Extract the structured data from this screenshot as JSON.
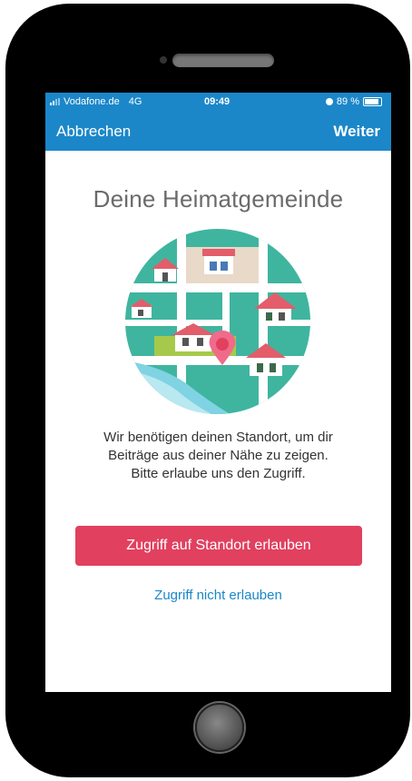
{
  "status_bar": {
    "carrier": "Vodafone.de",
    "network": "4G",
    "time": "09:49",
    "battery": "89 %"
  },
  "nav": {
    "cancel_label": "Abbrechen",
    "next_label": "Weiter"
  },
  "main": {
    "title": "Deine Heimatgemeinde",
    "description_lines": [
      "Wir benötigen deinen Standort, um dir",
      "Beiträge aus deiner Nähe zu zeigen.",
      "Bitte erlaube uns den Zugriff."
    ],
    "allow_button": "Zugriff auf Standort erlauben",
    "deny_link": "Zugriff nicht erlauben"
  },
  "colors": {
    "nav_blue": "#1b87c9",
    "accent_red": "#e1405f",
    "map_teal": "#3fb59f"
  },
  "icons": [
    "signal-icon",
    "alarm-icon",
    "battery-icon",
    "map-illustration",
    "location-pin-icon"
  ]
}
